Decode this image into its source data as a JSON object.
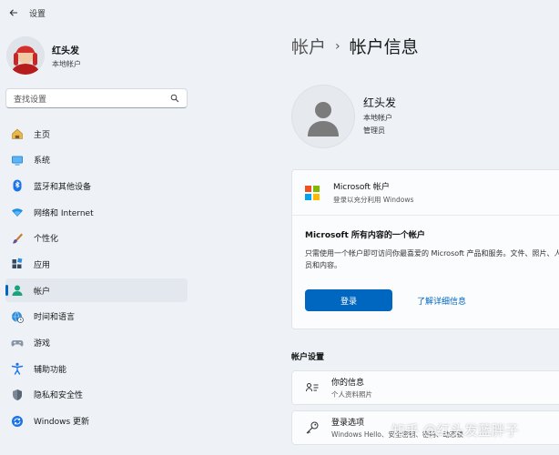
{
  "window": {
    "title": "设置"
  },
  "profile": {
    "name": "红头发",
    "account_type": "本地帐户"
  },
  "search": {
    "placeholder": "查找设置"
  },
  "nav": [
    {
      "label": "主页",
      "icon": "home-icon"
    },
    {
      "label": "系统",
      "icon": "display-icon"
    },
    {
      "label": "蓝牙和其他设备",
      "icon": "bluetooth-icon"
    },
    {
      "label": "网络和 Internet",
      "icon": "wifi-icon"
    },
    {
      "label": "个性化",
      "icon": "brush-icon"
    },
    {
      "label": "应用",
      "icon": "apps-icon"
    },
    {
      "label": "帐户",
      "icon": "person-icon",
      "active": true
    },
    {
      "label": "时间和语言",
      "icon": "globe-clock-icon"
    },
    {
      "label": "游戏",
      "icon": "gamepad-icon"
    },
    {
      "label": "辅助功能",
      "icon": "accessibility-icon"
    },
    {
      "label": "隐私和安全性",
      "icon": "shield-icon"
    },
    {
      "label": "Windows 更新",
      "icon": "update-icon"
    }
  ],
  "breadcrumb": {
    "parent": "帐户",
    "separator": "›",
    "current": "帐户信息"
  },
  "user": {
    "name": "红头发",
    "account_type": "本地帐户",
    "role": "管理员"
  },
  "microsoft_card": {
    "title": "Microsoft 帐户",
    "subtitle": "登录以充分利用 Windows",
    "body_title": "Microsoft 所有内容的一个帐户",
    "body_desc": "只需使用一个帐户即可访问你最喜爱的 Microsoft 产品和服务。文件、照片、人员和内容。",
    "signin_label": "登录",
    "learn_more_label": "了解详细信息"
  },
  "account_settings": {
    "section_title": "帐户设置",
    "items": [
      {
        "title": "你的信息",
        "subtitle": "个人资料照片",
        "icon": "contact-card-icon"
      },
      {
        "title": "登录选项",
        "subtitle": "Windows Hello、安全密钥、密码、动态锁",
        "icon": "key-icon"
      }
    ]
  },
  "watermark": {
    "text": "知乎 @红头发蓝胖子"
  },
  "colors": {
    "accent": "#0067c0",
    "background": "#eef2f7",
    "avatar_red": "#c62828"
  }
}
